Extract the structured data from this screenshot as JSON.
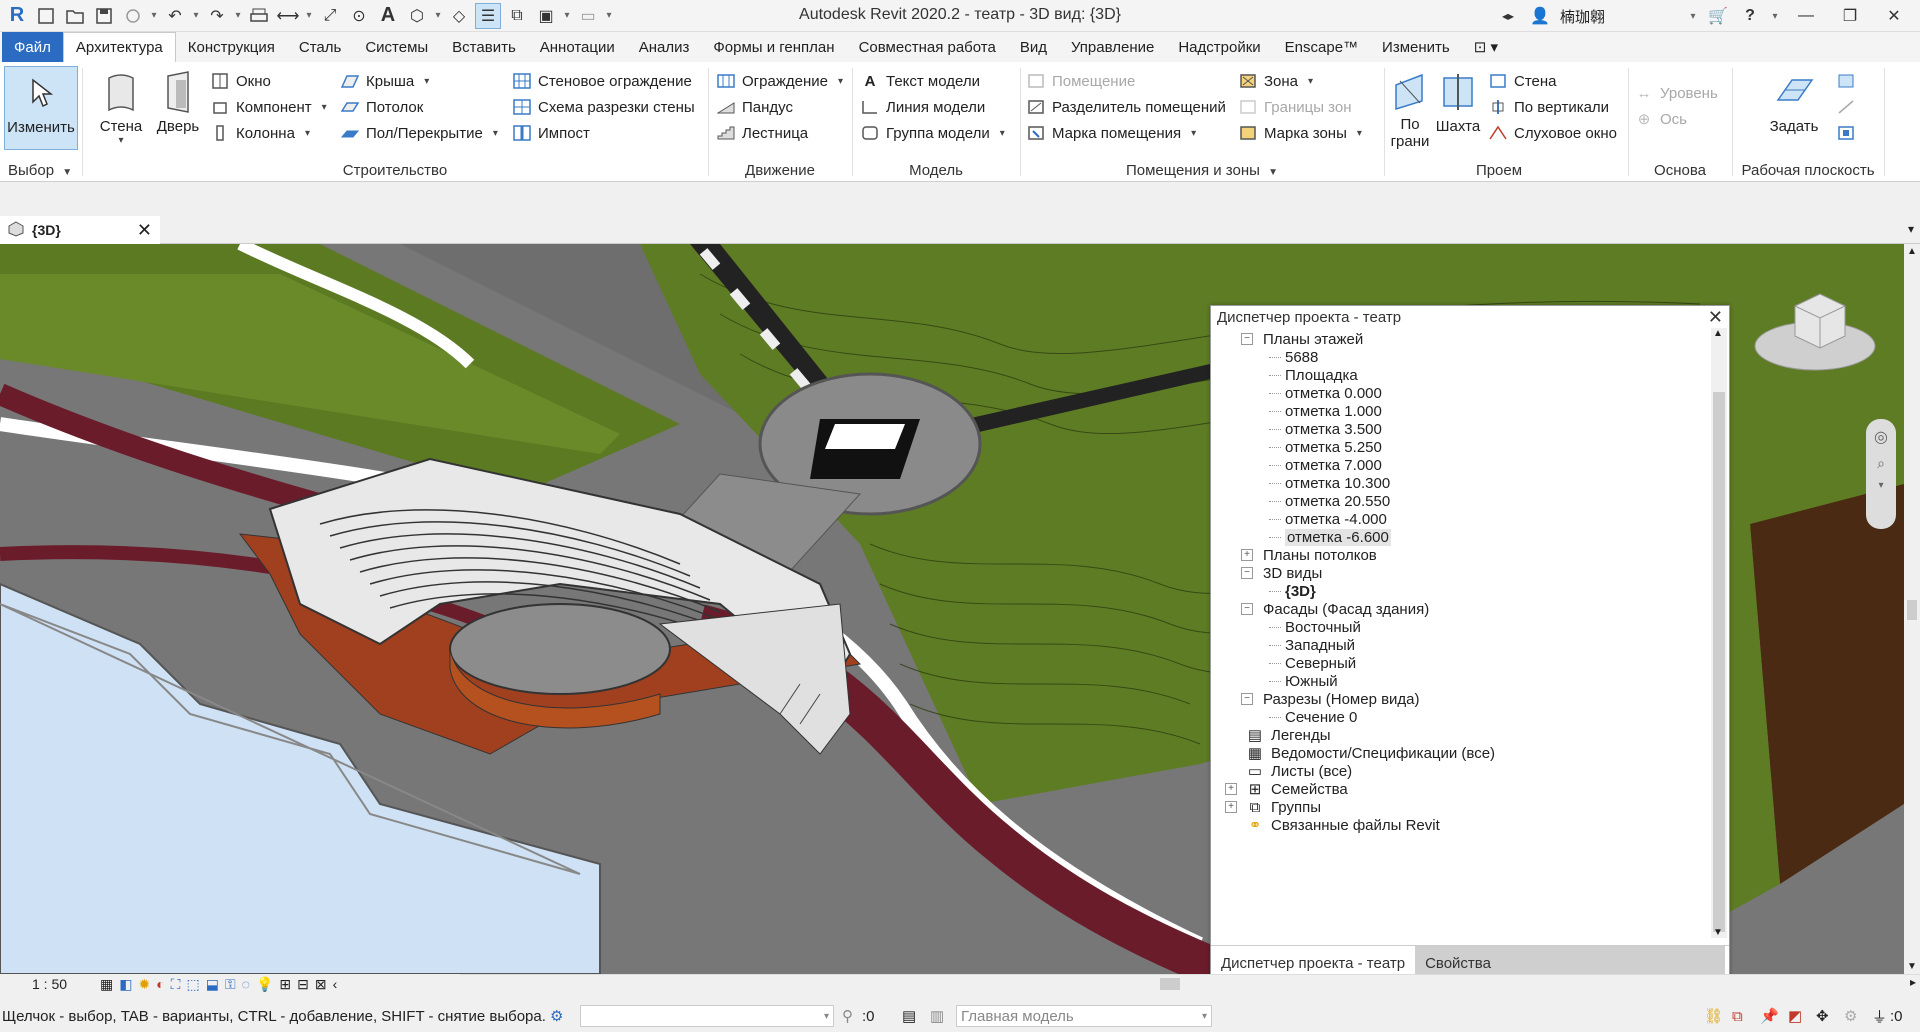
{
  "window": {
    "title": "Autodesk Revit 2020.2 - театр - 3D вид: {3D}",
    "user_name": "楠珈翱"
  },
  "tabs": [
    "Файл",
    "Архитектура",
    "Конструкция",
    "Сталь",
    "Системы",
    "Вставить",
    "Аннотации",
    "Анализ",
    "Формы и генплан",
    "Совместная работа",
    "Вид",
    "Управление",
    "Надстройки",
    "Enscape™",
    "Изменить"
  ],
  "ribbon": {
    "select": {
      "modify_label": "Изменить",
      "panel_title": "Выбор"
    },
    "build": {
      "wall": "Стена",
      "door": "Дверь",
      "window": "Окно",
      "component": "Компонент",
      "column": "Колонна",
      "roof": "Крыша",
      "ceiling": "Потолок",
      "floor": "Пол/Перекрытие",
      "curtain_system": "Стеновое ограждение",
      "curtain_grid": "Схема разрезки стены",
      "mullion": "Импост",
      "panel_title": "Строительство"
    },
    "circulation": {
      "railing": "Ограждение",
      "ramp": "Пандус",
      "stair": "Лестница",
      "panel_title": "Движение"
    },
    "model": {
      "model_text": "Текст модели",
      "model_line": "Линия модели",
      "model_group": "Группа модели",
      "panel_title": "Модель"
    },
    "room_area": {
      "room": "Помещение",
      "room_separator": "Разделитель помещений",
      "room_tag": "Марка помещения",
      "area": "Зона",
      "area_boundary": "Границы зон",
      "area_tag": "Марка зоны",
      "panel_title": "Помещения и зоны"
    },
    "opening": {
      "by_face": "По грани",
      "shaft": "Шахта",
      "wall": "Стена",
      "vertical": "По вертикали",
      "dormer": "Слуховое окно",
      "panel_title": "Проем"
    },
    "datum": {
      "level": "Уровень",
      "grid": "Ось",
      "panel_title": "Основа"
    },
    "work_plane": {
      "set": "Задать",
      "panel_title": "Рабочая плоскость"
    }
  },
  "view_tab": {
    "label": "{3D}"
  },
  "browser": {
    "title": "Диспетчер проекта - театр",
    "tree": [
      {
        "label": "Планы этажей",
        "level": 1,
        "toggle": "−"
      },
      {
        "label": "5688",
        "level": 2
      },
      {
        "label": "Площадка",
        "level": 2
      },
      {
        "label": "отметка 0.000",
        "level": 2
      },
      {
        "label": "отметка 1.000",
        "level": 2
      },
      {
        "label": "отметка 3.500",
        "level": 2
      },
      {
        "label": "отметка 5.250",
        "level": 2
      },
      {
        "label": "отметка 7.000",
        "level": 2
      },
      {
        "label": "отметка 10.300",
        "level": 2
      },
      {
        "label": "отметка 20.550",
        "level": 2
      },
      {
        "label": "отметка -4.000",
        "level": 2
      },
      {
        "label": "отметка -6.600",
        "level": 2,
        "selected": true
      },
      {
        "label": "Планы потолков",
        "level": 1,
        "toggle": "+"
      },
      {
        "label": "3D виды",
        "level": 1,
        "toggle": "−"
      },
      {
        "label": "{3D}",
        "level": 2,
        "bold": true
      },
      {
        "label": "Фасады (Фасад здания)",
        "level": 1,
        "toggle": "−"
      },
      {
        "label": "Восточный",
        "level": 2
      },
      {
        "label": "Западный",
        "level": 2
      },
      {
        "label": "Северный",
        "level": 2
      },
      {
        "label": "Южный",
        "level": 2
      },
      {
        "label": "Разрезы (Номер вида)",
        "level": 1,
        "toggle": "−"
      },
      {
        "label": "Сечение 0",
        "level": 2
      },
      {
        "label": "Легенды",
        "level": 0,
        "icon": "legend-icon"
      },
      {
        "label": "Ведомости/Спецификации (все)",
        "level": 0,
        "icon": "schedule-icon"
      },
      {
        "label": "Листы (все)",
        "level": 0,
        "icon": "sheet-icon"
      },
      {
        "label": "Семейства",
        "level": 0,
        "icon": "family-icon",
        "toggle": "+"
      },
      {
        "label": "Группы",
        "level": 0,
        "icon": "group-icon",
        "toggle": "+"
      },
      {
        "label": "Связанные файлы Revit",
        "level": 0,
        "icon": "link-icon"
      }
    ],
    "tab_active": "Диспетчер проекта - театр",
    "tab_inactive": "Свойства"
  },
  "viewbar": {
    "scale": "1 : 50"
  },
  "status": {
    "hint": "Щелчок - выбор, TAB - варианты, CTRL - добавление, SHIFT - снятие выбора.",
    "worksets_count": ":0",
    "main_model": "Главная модель",
    "filter_count": ":0"
  },
  "colors": {
    "accent": "#2b6cc2",
    "site_green": "#5b7a22",
    "brick": "#a1401f",
    "red_path": "#6b1c2b",
    "water": "#cfe2f5"
  }
}
